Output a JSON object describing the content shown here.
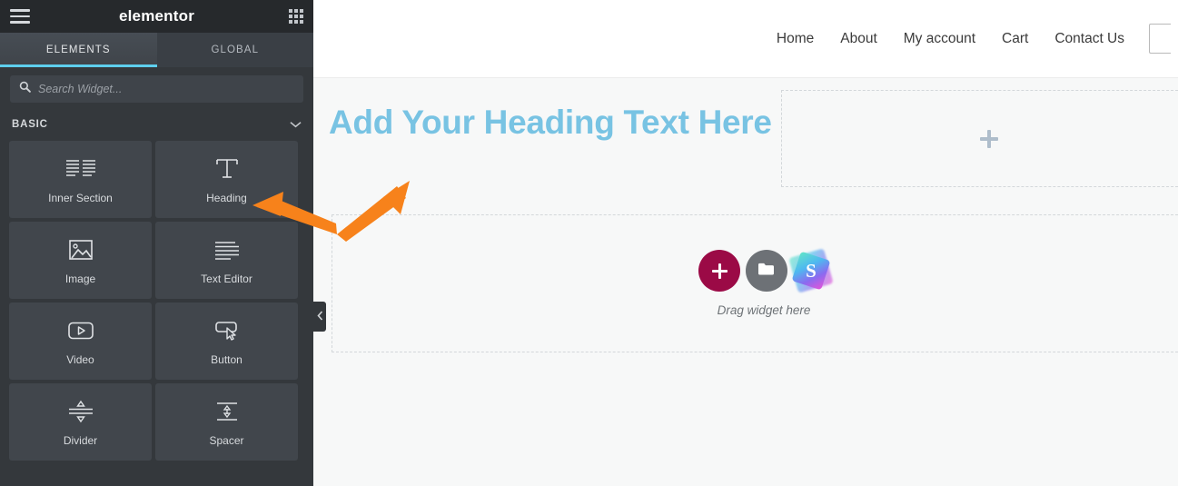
{
  "panel": {
    "brand": "elementor",
    "menu_icon": "hamburger-icon",
    "apps_icon": "grid-apps-icon",
    "tabs": [
      {
        "label": "ELEMENTS",
        "active": true
      },
      {
        "label": "GLOBAL",
        "active": false
      }
    ],
    "search": {
      "placeholder": "Search Widget...",
      "value": ""
    },
    "category": {
      "title": "BASIC",
      "collapsed": false
    },
    "widgets": [
      {
        "label": "Inner Section",
        "icon": "inner-section-icon"
      },
      {
        "label": "Heading",
        "icon": "heading-icon"
      },
      {
        "label": "Image",
        "icon": "image-icon"
      },
      {
        "label": "Text Editor",
        "icon": "text-editor-icon"
      },
      {
        "label": "Video",
        "icon": "video-icon"
      },
      {
        "label": "Button",
        "icon": "button-icon"
      },
      {
        "label": "Divider",
        "icon": "divider-icon"
      },
      {
        "label": "Spacer",
        "icon": "spacer-icon"
      }
    ],
    "collapse_icon": "chevron-left-icon"
  },
  "canvas": {
    "nav": [
      {
        "label": "Home"
      },
      {
        "label": "About"
      },
      {
        "label": "My account"
      },
      {
        "label": "Cart"
      },
      {
        "label": "Contact Us"
      }
    ],
    "heading": "Add Your Heading Text Here",
    "empty_section": {
      "add_icon": "plus-icon"
    },
    "drop_zone": {
      "label": "Drag widget here",
      "add_icon": "plus-icon",
      "folder_icon": "folder-icon",
      "logo_icon": "s-logo-icon",
      "logo_letter": "S"
    }
  },
  "annotation": {
    "type": "double-arrow",
    "color": "#f7821b"
  },
  "colors": {
    "panel_bg": "#34383c",
    "panel_header_bg": "#26292c",
    "widget_bg": "#41464c",
    "tab_accent": "#5ecfee",
    "heading_blue": "#78c3e3",
    "add_button": "#9b0a46",
    "folder_button": "#6d7176",
    "arrow_orange": "#f7821b"
  }
}
